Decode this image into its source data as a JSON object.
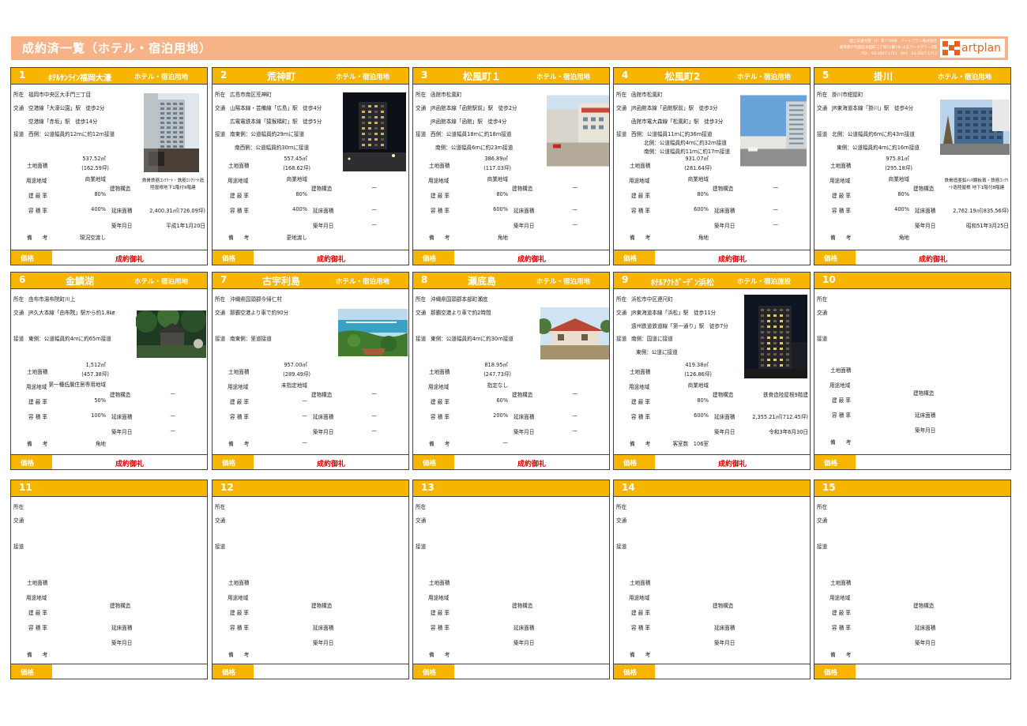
{
  "page": {
    "title": "成約済一覧（ホテル・宿泊用地）",
    "company_lines": [
      "国土交通大臣（4）第7758号　アートプラン株式会社",
      "東京都千代田区永田町二丁目11番1号 山王パークタワー3階",
      "TEL　03-3507-1711　FAX　03-3507-1712"
    ],
    "logo_text": "artplan"
  },
  "labels": {
    "location": "所在",
    "access": "交通",
    "road": "接道",
    "land_area": "土地面積",
    "zoning": "用途地域",
    "coverage": "建 蔽 率",
    "far": "容 積 率",
    "remarks": "備　　考",
    "structure": "建物構造",
    "floor_area": "延床面積",
    "built": "築年月日",
    "price": "価格"
  },
  "cards": [
    {
      "no": "1",
      "name": "ﾎﾃﾙｻﾝﾗｲﾝ福岡大濠",
      "type": "ホテル・宿泊用地",
      "location": "福岡市中央区大手門三丁目",
      "access": [
        "空港線「大濠公園」駅　徒歩2分",
        "空港線「赤坂」駅　徒歩14分"
      ],
      "road": [
        "西側：公道幅員約12ｍに約12ｍ接道"
      ],
      "land_area": "537.52㎡",
      "land_tsubo": "(162.59坪)",
      "zoning": "商業地域",
      "coverage": "80%",
      "far": "400%",
      "remarks": "現況空渡し",
      "structure": "鉄骨鉄筋ｺﾝｸﾘｰﾄ・鉄筋ｺﾝｸﾘｰﾄ造 陸屋根地下1階付9階建",
      "floor_area": "2,400.31㎡(726.09坪)",
      "built": "平成1年1月20日",
      "price": "成約御礼",
      "photo": "hotel-building"
    },
    {
      "no": "2",
      "name": "荒神町",
      "type": "ホテル・宿泊用地",
      "location": "広島市南区荒神町",
      "access": [
        "山陽本線・芸備線「広島」駅　徒歩4分",
        "広電電鉄本線「猿猴橋町」駅　徒歩5分"
      ],
      "road": [
        "南東側：公道幅員約29ｍに接道",
        "南西側：公道幅員約30ｍに接道"
      ],
      "land_area": "557.45㎡",
      "land_tsubo": "(168.62坪)",
      "zoning": "商業地域",
      "coverage": "80%",
      "far": "400%",
      "remarks": "更地渡し",
      "structure": "—",
      "floor_area": "—",
      "built": "—",
      "price": "成約御礼",
      "photo": "night-street"
    },
    {
      "no": "3",
      "name": "松風町１",
      "type": "ホテル・宿泊用地",
      "location": "函館市松風町",
      "access": [
        "JR函館本線「函館駅前」駅　徒歩2分",
        "JR函館本線「函館」駅　徒歩4分"
      ],
      "road": [
        "西側：公道幅員18ｍに約18ｍ接道",
        "南側：公道幅員6ｍに約23ｍ接道"
      ],
      "land_area": "386.89㎡",
      "land_tsubo": "(117.03坪)",
      "zoning": "商業地域",
      "coverage": "80%",
      "far": "600%",
      "remarks": "角地",
      "structure": "—",
      "floor_area": "—",
      "built": "—",
      "price": "成約御礼",
      "photo": "parking-lot"
    },
    {
      "no": "4",
      "name": "松風町2",
      "type": "ホテル・宿泊用地",
      "location": "函館市松風町",
      "access": [
        "JR函館本線「函館駅前」駅　徒歩3分",
        "函館市電大森線「松風町」駅　徒歩3分"
      ],
      "road": [
        "西側：公道幅員11ｍに約36ｍ接道",
        "北側：公道幅員約4ｍに約32ｍ接道",
        "南側：公道幅員約11ｍに約17ｍ接道"
      ],
      "land_area": "931.07㎡",
      "land_tsubo": "(281.64坪)",
      "zoning": "商業地域",
      "coverage": "80%",
      "far": "600%",
      "remarks": "角地",
      "structure": "—",
      "floor_area": "—",
      "built": "—",
      "price": "成約御礼",
      "photo": "sky-street"
    },
    {
      "no": "5",
      "name": "掛川",
      "type": "ホテル・宿泊用地",
      "location": "掛川市紺屋町",
      "access": [
        "JR東海道本線「掛川」駅　徒歩4分"
      ],
      "road": [
        "北側：公道幅員約6ｍに約43ｍ接道",
        "東側：公道幅員約4ｍに約16ｍ接道"
      ],
      "land_area": "975.81㎡",
      "land_tsubo": "(295.18坪)",
      "zoning": "商業地域",
      "coverage": "80%",
      "far": "400%",
      "remarks": "角地",
      "structure": "鉄骨造亜鉛ﾒｯｷ鋼板葺・鉄筋ｺﾝｸﾘｰﾄ造陸屋根 地下1階付8階建",
      "floor_area": "2,762.19㎡(835.56坪)",
      "built": "昭和51年3月25日",
      "price": "成約御礼",
      "photo": "blue-building"
    },
    {
      "no": "6",
      "name": "金鱗湖",
      "type": "ホテル・宿泊用地",
      "location": "由布市湯布院町川上",
      "access": [
        "JR久大本線「由布院」駅から約1.8㎞"
      ],
      "road": [
        "東側：公道幅員約4ｍに約65ｍ接道"
      ],
      "land_area": "1,512㎡",
      "land_tsubo": "(457.38坪)",
      "zoning": "第一種低層住居専用地域",
      "coverage": "50%",
      "far": "100%",
      "remarks": "角地",
      "structure": "—",
      "floor_area": "—",
      "built": "—",
      "price": "成約御礼",
      "photo": "forest-house"
    },
    {
      "no": "7",
      "name": "古宇利島",
      "type": "ホテル・宿泊用地",
      "location": "沖縄県国頭郡今帰仁村",
      "access": [
        "那覇空港より車で約90分"
      ],
      "road": [
        "南東側：里道接道"
      ],
      "land_area": "957.00㎡",
      "land_tsubo": "(289.49坪)",
      "zoning": "未指定地域",
      "coverage": "—",
      "far": "—",
      "remarks": "—",
      "structure": "—",
      "floor_area": "—",
      "built": "—",
      "price": "成約御礼",
      "photo": "ocean-bridge"
    },
    {
      "no": "8",
      "name": "瀬底島",
      "type": "ホテル・宿泊用地",
      "location": "沖縄県国頭郡本部町瀬底",
      "access": [
        "那覇空港より車で約2時間"
      ],
      "road": [
        "東側：公道幅員約4ｍに約30ｍ接道"
      ],
      "land_area": "818.95㎡",
      "land_tsubo": "(247.73坪)",
      "zoning": "指定なし",
      "coverage": "60%",
      "far": "200%",
      "remarks": "—",
      "structure": "—",
      "floor_area": "—",
      "built": "—",
      "price": "成約御礼",
      "photo": "red-roof-house"
    },
    {
      "no": "9",
      "name": "ﾎﾃﾙｱｸﾄｶﾞｰﾃﾞﾝ浜松",
      "type": "ホテル・宿泊施設",
      "location": "浜松市中区連尺町",
      "access": [
        "JR東海道本線「浜松」駅　徒歩11分",
        "遠州鉄道鉄道線「第一通り」駅　徒歩7分"
      ],
      "road": [
        "南側：国道に接道",
        "東側：公道に接道"
      ],
      "land_area": "419.38㎡",
      "land_tsubo": "(126.86坪)",
      "zoning": "商業地域",
      "coverage": "80%",
      "far": "600%",
      "remarks": "客室数　106室",
      "structure": "鉄骨造陸屋根9階建",
      "floor_area": "2,355.21㎡(712.45坪)",
      "built": "令和3年6月30日",
      "price": "成約御礼",
      "photo": "night-tower"
    },
    {
      "no": "10"
    },
    {
      "no": "11"
    },
    {
      "no": "12"
    },
    {
      "no": "13"
    },
    {
      "no": "14"
    },
    {
      "no": "15"
    }
  ]
}
